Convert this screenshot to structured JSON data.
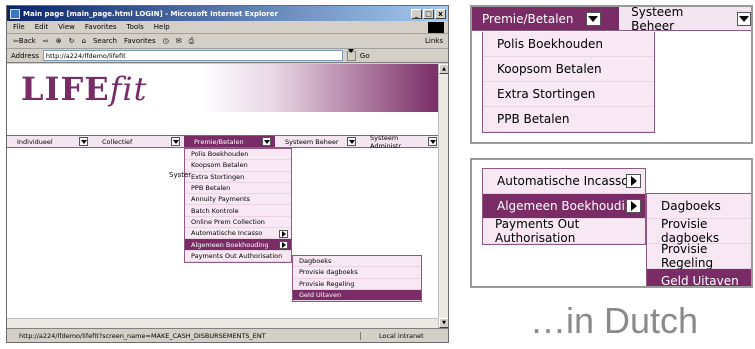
{
  "window": {
    "title": "Main page [main_page.html LOGIN] - Microsoft Internet Explorer",
    "controls": [
      "_",
      "□",
      "x"
    ]
  },
  "menubar": [
    "File",
    "Edit",
    "View",
    "Favorites",
    "Tools",
    "Help"
  ],
  "toolbar": {
    "back": "⇦Back",
    "search": "Search",
    "favorites": "Favorites",
    "links": "Links"
  },
  "address": {
    "label": "Address",
    "url": "http://a224/lfdemo/lifefit",
    "go": "Go"
  },
  "brand": {
    "part1": "LIFE",
    "part2": "fit"
  },
  "nav": {
    "items": [
      "Individueel",
      "Collectief",
      "Premie/Betalen",
      "Systeem Beheer",
      "Systeem Administr"
    ]
  },
  "menu_main": [
    "Polis Boekhouden",
    "Koopsom Betalen",
    "Extra Stortingen",
    "PPB Betalen",
    "Annuity Payments",
    "Batch Kontrole",
    "Online Prem Collection",
    "Automatische Incasso",
    "Algemeen Boekhouding",
    "Payments Out Authorisation"
  ],
  "menu_sub": [
    "Dagboeks",
    "Provisie dagboeks",
    "Provisie Regeling",
    "Geld Uitaven"
  ],
  "page_text": "Syster",
  "status": {
    "url": "http://a224/lfdemo/lifefit?screen_name=MAKE_CASH_DISBURSEMENTS_ENT",
    "zone": "Local intranet"
  },
  "zoom1": {
    "nav": [
      "Premie/Betalen",
      "Systeem Beheer"
    ],
    "items": [
      "Polis Boekhouden",
      "Koopsom Betalen",
      "Extra Stortingen",
      "PPB Betalen"
    ]
  },
  "zoom2": {
    "items": [
      "Automatische Incasso",
      "Algemeen Boekhouding",
      "Payments Out Authorisation"
    ],
    "sub": [
      "Dagboeks",
      "Provisie dagboeks",
      "Provisie Regeling",
      "Geld Uitaven"
    ]
  },
  "caption": "…in Dutch",
  "colors": {
    "accent": "#7a2c66",
    "menu_bg": "#f7e8f3",
    "nav_bg": "#f3e6f0"
  }
}
